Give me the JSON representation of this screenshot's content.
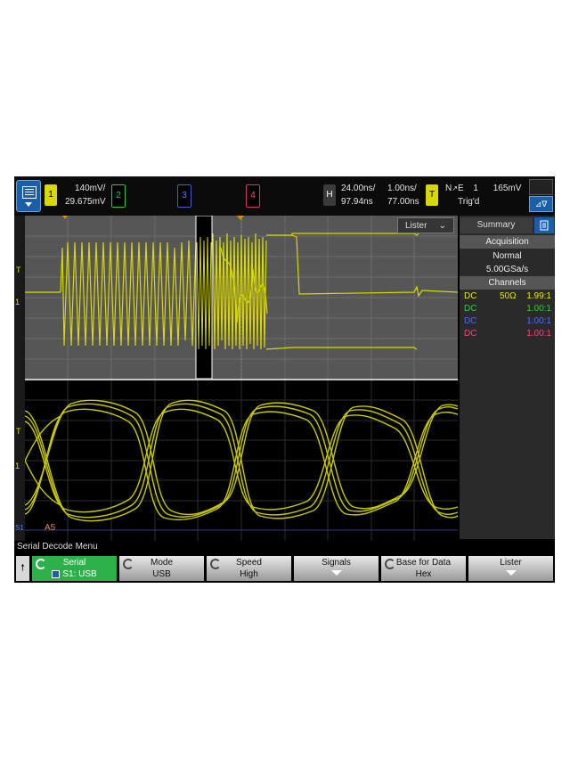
{
  "topbar": {
    "ch1": {
      "num": "1",
      "scale": "140mV/",
      "offset": "29.675mV",
      "color": "#d8d800"
    },
    "ch2": {
      "num": "2",
      "color": "#2fd02f"
    },
    "ch3": {
      "num": "3",
      "color": "#3f5fd6"
    },
    "ch4": {
      "num": "4",
      "color": "#e0306a"
    },
    "horizontal": {
      "label": "H",
      "timebase": "24.00ns/",
      "delay": "97.94ns",
      "scale2": "1.00ns/",
      "delay2": "77.00ns"
    },
    "trigger": {
      "label": "T",
      "mode": "N",
      "edge": "E",
      "source": "1",
      "level": "165mV",
      "status": "Trig'd"
    }
  },
  "lister_button": "Lister",
  "axis_markers": {
    "trigger": "T",
    "ch1_ground": "1",
    "s1": "S1"
  },
  "decode_label": "A5",
  "panel": {
    "tab": "Summary",
    "acquisition_header": "Acquisition",
    "acq_mode": "Normal",
    "sample_rate": "5.00GSa/s",
    "channels_header": "Channels",
    "channels": [
      {
        "coupling": "DC",
        "impedance": "50Ω",
        "ratio": "1.99:1",
        "color": "#e8e800"
      },
      {
        "coupling": "DC",
        "impedance": "",
        "ratio": "1.00:1",
        "color": "#2fd02f"
      },
      {
        "coupling": "DC",
        "impedance": "",
        "ratio": "1.00:1",
        "color": "#4a6aff"
      },
      {
        "coupling": "DC",
        "impedance": "",
        "ratio": "1.00:1",
        "color": "#ff3f8a"
      }
    ]
  },
  "menu_title": "Serial Decode Menu",
  "softkeys": [
    {
      "label": "Serial",
      "value": "S1: USB"
    },
    {
      "label": "Mode",
      "value": "USB"
    },
    {
      "label": "Speed",
      "value": "High"
    },
    {
      "label": "Signals",
      "value": ""
    },
    {
      "label": "Base for Data",
      "value": "Hex"
    },
    {
      "label": "Lister",
      "value": ""
    }
  ]
}
